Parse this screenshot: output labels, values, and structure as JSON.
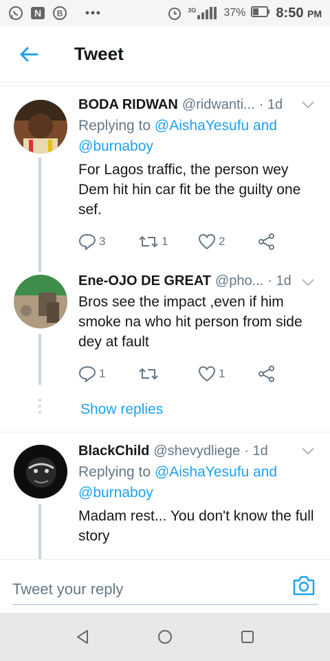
{
  "status_bar": {
    "icons": [
      "whatsapp-icon",
      "n-icon",
      "b-icon"
    ],
    "dots": "•••",
    "network": "3G",
    "battery_percent": "37%",
    "time": "8:50",
    "ampm": "PM"
  },
  "header": {
    "back_icon": "back-arrow-icon",
    "title": "Tweet"
  },
  "tweets": [
    {
      "name": "BODA RIDWAN",
      "handle": "@ridwanti...",
      "time": "· 1d",
      "replying_prefix": "Replying to ",
      "replying_mention_1": "@AishaYesufu and",
      "replying_mention_2": "@burnaboy",
      "text": "For Lagos traffic, the person wey Dem hit hin car fit be the guilty one sef.",
      "replies": "3",
      "retweets": "1",
      "likes": "2"
    },
    {
      "name": "Ene-OJO DE GREAT",
      "handle": "@pho...",
      "time": "· 1d",
      "text": "Bros see the impact ,even if him smoke na who hit person from side dey at fault",
      "replies": "1",
      "retweets": "",
      "likes": "1"
    },
    {
      "name": "BlackChild",
      "handle": "@shevydliege",
      "time": "· 1d",
      "replying_prefix": "Replying to ",
      "replying_mention_1": "@AishaYesufu and",
      "replying_mention_2": "@burnaboy",
      "text": "Madam rest... You don't know the full story"
    }
  ],
  "show_replies": "Show replies",
  "reply_bar": {
    "placeholder": "Tweet your reply"
  },
  "colors": {
    "accent": "#1da1f2",
    "secondary_text": "#657786",
    "thread_line": "#ccd6dd"
  }
}
